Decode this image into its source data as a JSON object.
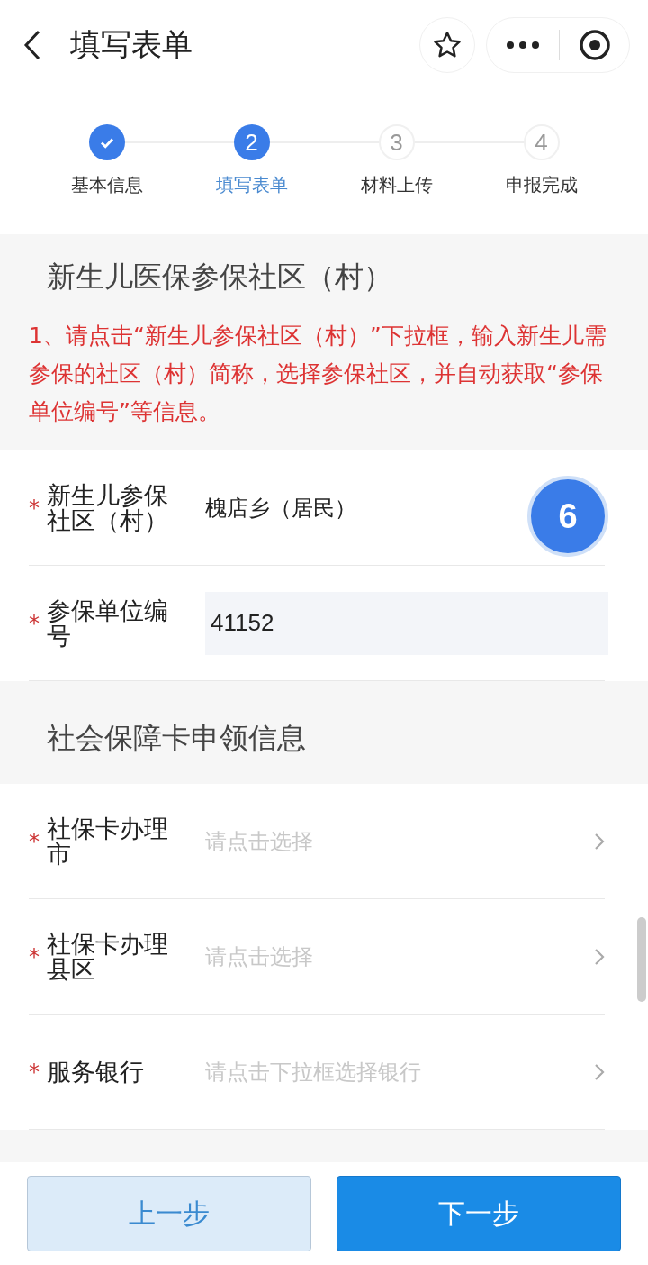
{
  "header": {
    "title": "填写表单"
  },
  "steps": [
    {
      "label": "基本信息",
      "done": true,
      "selected": false
    },
    {
      "number": "2",
      "label": "填写表单",
      "done": false,
      "selected": true
    },
    {
      "number": "3",
      "label": "材料上传",
      "done": false,
      "selected": false
    },
    {
      "number": "4",
      "label": "申报完成",
      "done": false,
      "selected": false
    }
  ],
  "sections": [
    {
      "title": "新生儿医保参保社区（村）",
      "note": "1、请点击“新生儿参保社区（村）”下拉框，输入新生儿需参保的社区（村）简称，选择参保社区，并自动获取“参保单位编号”等信息。",
      "fields": [
        {
          "label": "新生儿参保社区（村）",
          "required_mark": "*",
          "kind": "text",
          "value": "槐店乡（居民）"
        },
        {
          "label": "参保单位编号",
          "required_mark": "*",
          "kind": "masked",
          "value": "41152"
        }
      ]
    },
    {
      "title": "社会保障卡申领信息",
      "fields": [
        {
          "label": "社保卡办理市",
          "required_mark": "*",
          "kind": "select",
          "placeholder": "请点击选择"
        },
        {
          "label": "社保卡办理县区",
          "required_mark": "*",
          "kind": "select",
          "placeholder": "请点击选择"
        },
        {
          "label": "服务银行",
          "required_mark": "*",
          "kind": "select",
          "placeholder": "请点击下拉框选择银行"
        }
      ]
    }
  ],
  "badge": "6",
  "buttons": [
    {
      "label": "上一步",
      "kind": "secondary"
    },
    {
      "label": "下一步",
      "kind": "primary"
    }
  ]
}
